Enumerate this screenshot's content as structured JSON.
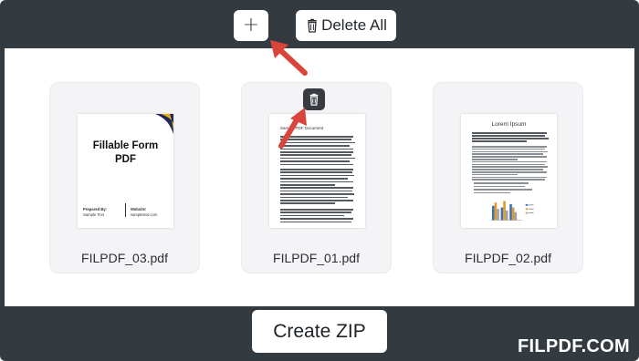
{
  "toolbar": {
    "add_label": "+",
    "delete_all_label": "Delete All"
  },
  "files": [
    {
      "name": "FILPDF_03.pdf",
      "thumbnail": {
        "title": "Fillable Form PDF",
        "prepared_by_label": "Prepared By:",
        "prepared_by_value": "Sample Text",
        "website_label": "Website:",
        "website_value": "sampletext.com"
      }
    },
    {
      "name": "FILPDF_01.pdf",
      "thumbnail": {
        "heading": "Sample PDF Document"
      }
    },
    {
      "name": "FILPDF_02.pdf",
      "thumbnail": {
        "title": "Lorem Ipsum"
      }
    }
  ],
  "actions": {
    "create_zip_label": "Create ZIP"
  },
  "brand": "FILPDF.COM",
  "colors": {
    "frame": "#343b40",
    "arrow": "#d9453a",
    "accent_gold": "#e8b10f",
    "accent_navy": "#1f2a5a"
  },
  "icons": {
    "add": "plus-icon",
    "delete_all": "trash-icon",
    "card_delete": "trash-icon"
  }
}
